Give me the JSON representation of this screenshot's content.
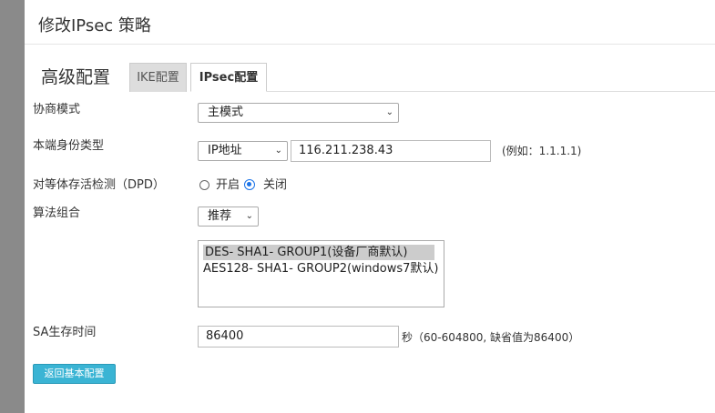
{
  "dialog": {
    "title": "修改IPsec 策略"
  },
  "section": {
    "title": "高级配置"
  },
  "tabs": [
    {
      "label": "IKE配置",
      "active": false
    },
    {
      "label": "IPsec配置",
      "active": true
    }
  ],
  "form": {
    "negotiation_mode": {
      "label": "协商模式",
      "value": "主模式"
    },
    "local_identity": {
      "label": "本端身份类型",
      "type_value": "IP地址",
      "address_value": "116.211.238.43",
      "hint": "(例如：1.1.1.1)"
    },
    "dpd": {
      "label": "对等体存活检测（DPD）",
      "options": [
        {
          "label": "开启",
          "checked": false
        },
        {
          "label": "关闭",
          "checked": true
        }
      ]
    },
    "algorithm": {
      "label": "算法组合",
      "value": "推荐",
      "list": [
        {
          "label": "DES- SHA1- GROUP1(设备厂商默认)",
          "selected": true
        },
        {
          "label": "AES128- SHA1- GROUP2(windows7默认)",
          "selected": false
        }
      ]
    },
    "sa_lifetime": {
      "label": "SA生存时间",
      "value": "86400",
      "hint": "秒（60-604800, 缺省值为86400）"
    }
  },
  "buttons": {
    "back_label": "返回基本配置"
  },
  "colors": {
    "accent_button": "#3ab4d4",
    "radio_checked": "#1a73e8"
  }
}
